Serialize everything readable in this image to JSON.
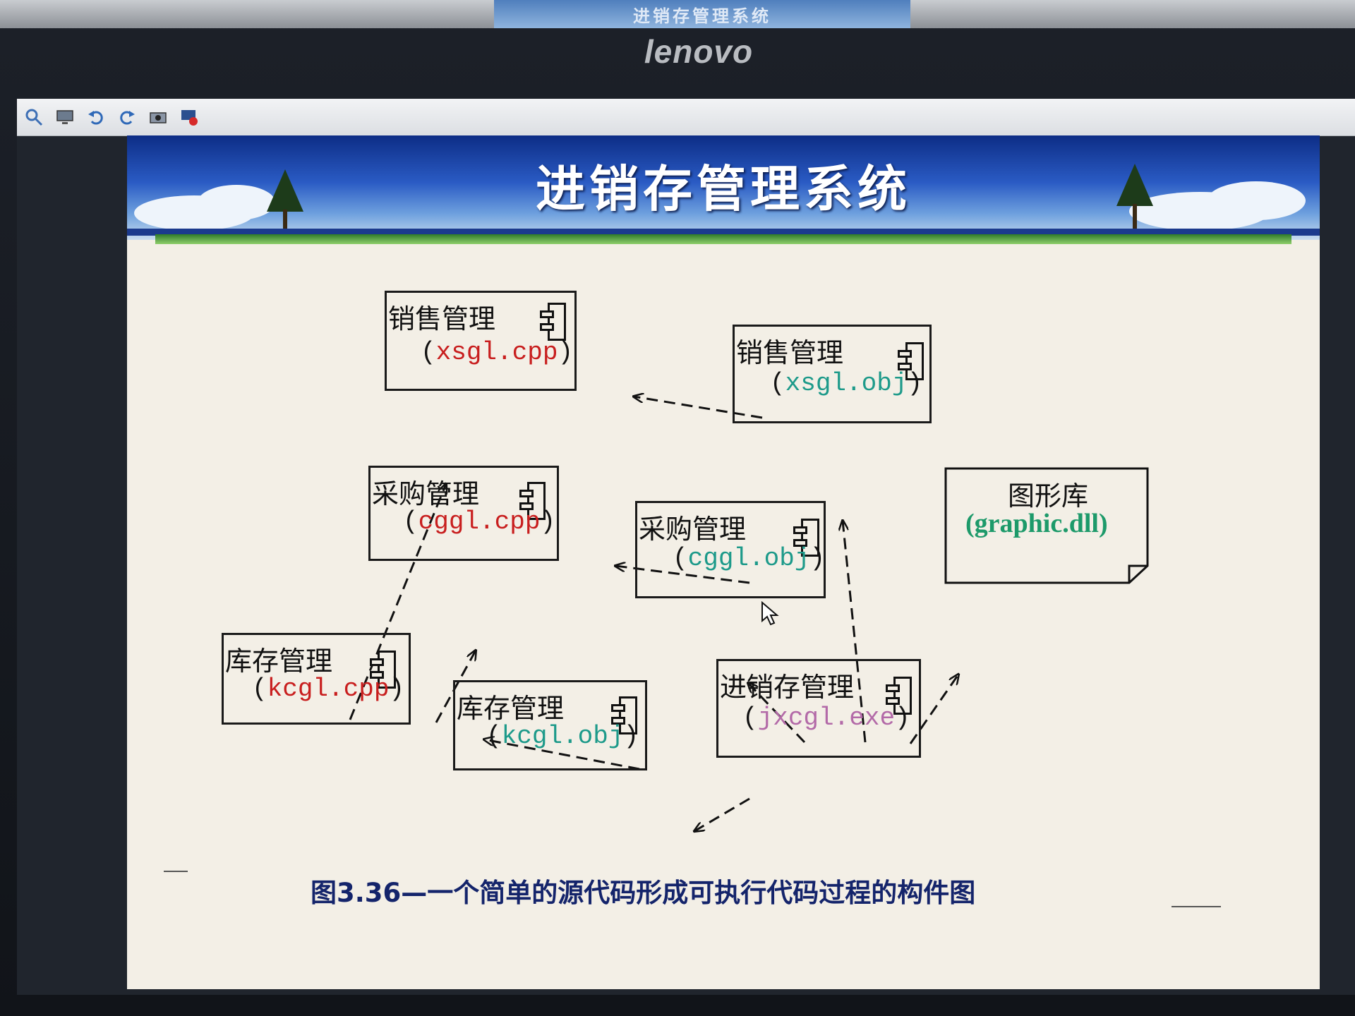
{
  "background_screen": {
    "text": "进销存管理系统"
  },
  "monitor": {
    "brand": "lenovo"
  },
  "toolbar": {
    "icons": [
      "zoom-icon",
      "monitor-icon",
      "undo-icon",
      "redo-icon",
      "camera-icon",
      "screen-record-icon"
    ]
  },
  "slide": {
    "title": "进销存管理系统",
    "caption": "图3.36—一个简单的源代码形成可执行代码过程的构件图"
  },
  "diagram": {
    "nodes": [
      {
        "id": "xsgl_cpp",
        "title": "销售管理",
        "file_open": "(",
        "file": "xsgl.cpp",
        "file_close": ")",
        "kind": "cpp"
      },
      {
        "id": "xsgl_obj",
        "title": "销售管理",
        "file_open": "(",
        "file": "xsgl.obj",
        "file_close": ")",
        "kind": "obj"
      },
      {
        "id": "cggl_cpp",
        "title": "采购管理",
        "file_open": "(",
        "file": "cggl.cpp",
        "file_close": ")",
        "kind": "cpp"
      },
      {
        "id": "cggl_obj",
        "title": "采购管理",
        "file_open": "(",
        "file": "cggl.obj",
        "file_close": ")",
        "kind": "obj"
      },
      {
        "id": "graphic_dll",
        "title": "图形库",
        "file": "(graphic.dll)",
        "kind": "dll"
      },
      {
        "id": "kcgl_cpp",
        "title": "库存管理",
        "file_open": "(",
        "file": "kcgl.cpp",
        "file_close": ")",
        "kind": "cpp"
      },
      {
        "id": "kcgl_obj",
        "title": "库存管理",
        "file_open": "(",
        "file": "kcgl.obj",
        "file_close": ")",
        "kind": "obj"
      },
      {
        "id": "jxcgl_exe",
        "title": "进销存管理",
        "file_open": "(",
        "file": "jxcgl.exe",
        "file_close": ")",
        "kind": "exe"
      }
    ],
    "dependencies": [
      {
        "from": "xsgl_obj",
        "to": "xsgl_cpp"
      },
      {
        "from": "cggl_obj",
        "to": "cggl_cpp"
      },
      {
        "from": "kcgl_obj",
        "to": "kcgl_cpp"
      },
      {
        "from": "kcgl_cpp",
        "to": "xsgl_cpp"
      },
      {
        "from": "kcgl_cpp",
        "to": "cggl_cpp"
      },
      {
        "from": "jxcgl_exe",
        "to": "xsgl_obj"
      },
      {
        "from": "jxcgl_exe",
        "to": "cggl_obj"
      },
      {
        "from": "jxcgl_exe",
        "to": "kcgl_obj"
      },
      {
        "from": "jxcgl_exe",
        "to": "graphic_dll"
      }
    ]
  },
  "colors": {
    "cpp": "#c81e1e",
    "obj": "#1d9a8a",
    "exe": "#b36aa8",
    "dll": "#1d9a6a",
    "caption": "#14246b"
  }
}
